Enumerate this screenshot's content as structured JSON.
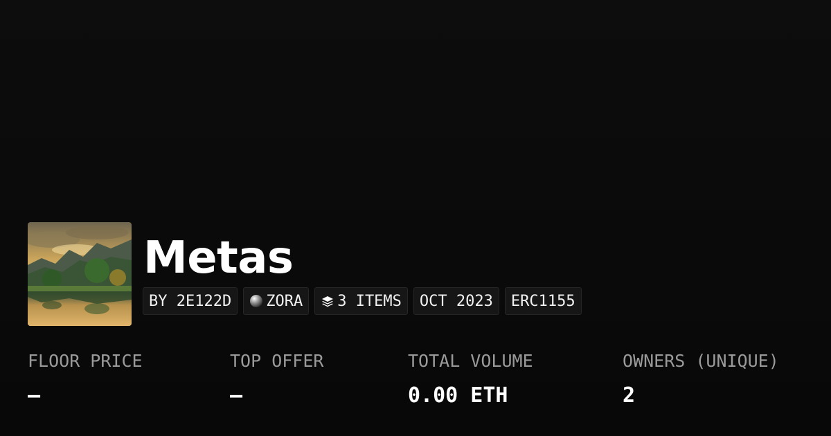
{
  "collection": {
    "title": "Metas",
    "image_icon": "landscape-thumbnail"
  },
  "tags": {
    "creator": "BY 2E122D",
    "chain": "ZORA",
    "chain_icon": "zora-orb-icon",
    "items": "3 ITEMS",
    "items_icon": "layers-icon",
    "date": "OCT 2023",
    "standard": "ERC1155"
  },
  "stats": {
    "floor_price": {
      "label": "FLOOR PRICE",
      "value": "–"
    },
    "top_offer": {
      "label": "TOP OFFER",
      "value": "–"
    },
    "total_volume": {
      "label": "TOTAL VOLUME",
      "value": "0.00 ETH"
    },
    "owners": {
      "label": "OWNERS (UNIQUE)",
      "value": "2"
    }
  },
  "colors": {
    "background": "#0a0a0a",
    "tag_background": "#161616",
    "label": "#9a9a9a",
    "text": "#ffffff"
  }
}
